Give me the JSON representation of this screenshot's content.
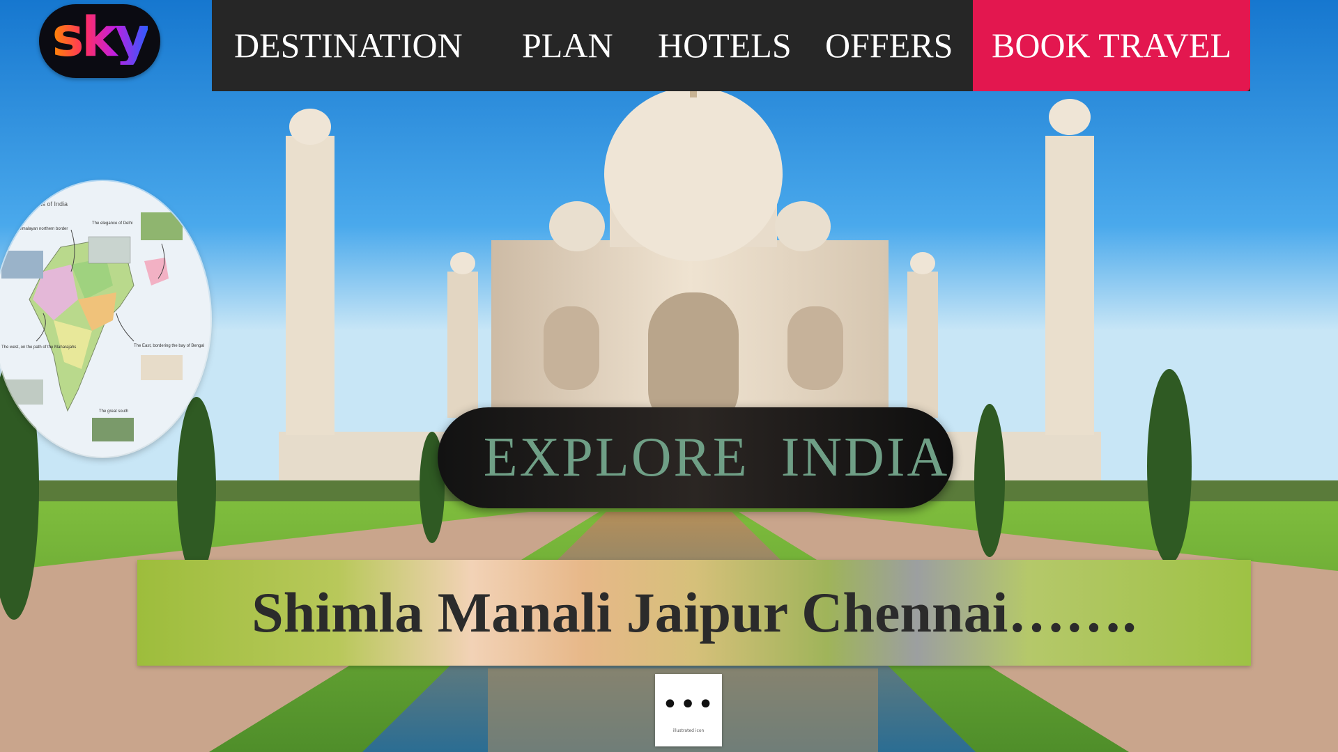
{
  "brand": {
    "logo_text": "sky"
  },
  "nav": {
    "items": [
      {
        "label": "DESTINATION"
      },
      {
        "label": "PLAN"
      },
      {
        "label": "HOTELS"
      },
      {
        "label": "OFFERS"
      }
    ],
    "cta_label": "BOOK TRAVEL"
  },
  "hero": {
    "explore_label": "EXPLORE  INDIA",
    "cities_text": "Shimla Manali Jaipur Chennai……."
  },
  "map": {
    "title": "Regions of India",
    "captions": [
      "The Himalayan northern border",
      "The elegance of Delhi",
      "The west, on the path of the Maharajahs",
      "The East, bordering the bay of Bengal",
      "The great south"
    ]
  },
  "more_button": {
    "label": "•••",
    "caption": "illustrated icon"
  },
  "colors": {
    "navbar_bg": "#262626",
    "cta_bg": "#e3174f",
    "explore_text": "#6f9f86",
    "cities_text": "#2b2b2b"
  },
  "icons": {
    "logo": "sky-logo",
    "more": "more-dots-icon"
  }
}
